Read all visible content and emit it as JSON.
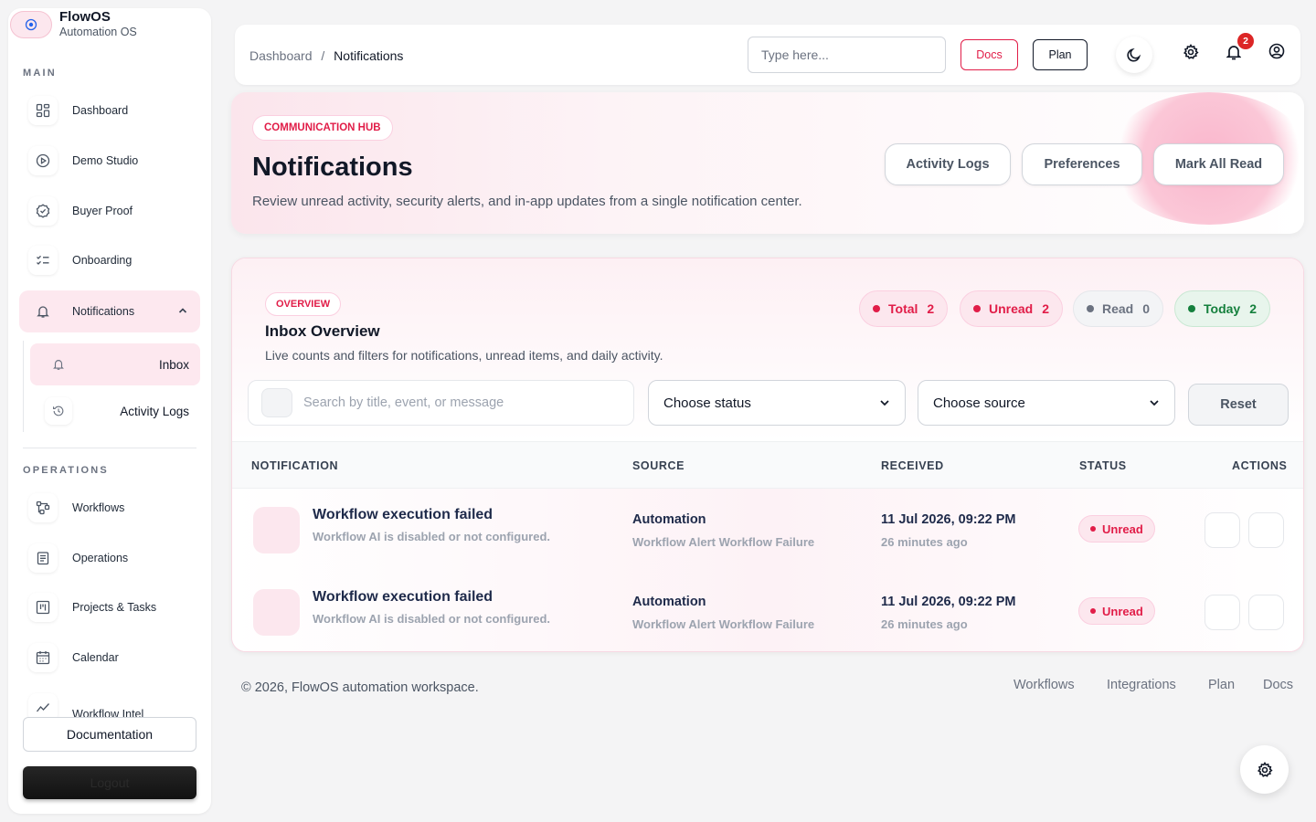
{
  "brand": {
    "name": "FlowOS",
    "subtitle": "Automation OS",
    "logo_icon": "target-icon"
  },
  "sidebar": {
    "main_label": "MAIN",
    "operations_label": "OPERATIONS",
    "main_items": [
      {
        "label": "Dashboard",
        "icon": "grid-icon"
      },
      {
        "label": "Demo Studio",
        "icon": "play-icon"
      },
      {
        "label": "Buyer Proof",
        "icon": "badge-check-icon"
      },
      {
        "label": "Onboarding",
        "icon": "checklist-icon"
      },
      {
        "label": "Notifications",
        "icon": "bell-icon",
        "active": true,
        "expanded": true
      }
    ],
    "sub_items": [
      {
        "label": "Inbox",
        "icon": "bell-icon",
        "active": true
      },
      {
        "label": "Activity Logs",
        "icon": "history-icon"
      }
    ],
    "operations_items": [
      {
        "label": "Workflows",
        "icon": "workflow-icon"
      },
      {
        "label": "Operations",
        "icon": "clipboard-icon"
      },
      {
        "label": "Projects & Tasks",
        "icon": "kanban-icon"
      },
      {
        "label": "Calendar",
        "icon": "calendar-icon"
      },
      {
        "label": "Workflow Intel",
        "icon": "chart-line-icon"
      }
    ],
    "documentation_label": "Documentation",
    "logout_label": "Logout"
  },
  "topbar": {
    "breadcrumb_root": "Dashboard",
    "breadcrumb_sep": "/",
    "breadcrumb_current": "Notifications",
    "search_placeholder": "Type here...",
    "docs_label": "Docs",
    "plan_label": "Plan",
    "notification_count": "2"
  },
  "hero": {
    "chip": "COMMUNICATION HUB",
    "title": "Notifications",
    "description": "Review unread activity, security alerts, and in-app updates from a single notification center.",
    "buttons": [
      "Activity Logs",
      "Preferences",
      "Mark All Read"
    ]
  },
  "overview": {
    "chip": "OVERVIEW",
    "title": "Inbox Overview",
    "description": "Live counts and filters for notifications, unread items, and daily activity.",
    "stats": [
      {
        "label": "Total",
        "value": "2",
        "color": "#e11d48"
      },
      {
        "label": "Unread",
        "value": "2",
        "color": "#e11d48"
      },
      {
        "label": "Read",
        "value": "0",
        "color": "#6b7280"
      },
      {
        "label": "Today",
        "value": "2",
        "color": "#15803d"
      }
    ],
    "search_placeholder": "Search by title, event, or message",
    "status_select": "Choose status",
    "source_select": "Choose source",
    "reset_label": "Reset"
  },
  "table": {
    "headers": [
      "NOTIFICATION",
      "SOURCE",
      "RECEIVED",
      "STATUS",
      "ACTIONS"
    ],
    "rows": [
      {
        "title": "Workflow execution failed",
        "message": "Workflow AI is disabled or not configured.",
        "source": "Automation",
        "source_detail": "Workflow Alert Workflow Failure",
        "received": "11 Jul 2026, 09:22 PM",
        "received_ago": "26 minutes ago",
        "status": "Unread"
      },
      {
        "title": "Workflow execution failed",
        "message": "Workflow AI is disabled or not configured.",
        "source": "Automation",
        "source_detail": "Workflow Alert Workflow Failure",
        "received": "11 Jul 2026, 09:22 PM",
        "received_ago": "26 minutes ago",
        "status": "Unread"
      }
    ]
  },
  "footer": {
    "copyright": "© 2026, FlowOS automation workspace.",
    "links": [
      "Workflows",
      "Integrations",
      "Plan",
      "Docs"
    ]
  },
  "colors": {
    "accent": "#e11d48",
    "accent_soft": "#fce7ee",
    "success": "#15803d",
    "text_dark": "#111827"
  }
}
